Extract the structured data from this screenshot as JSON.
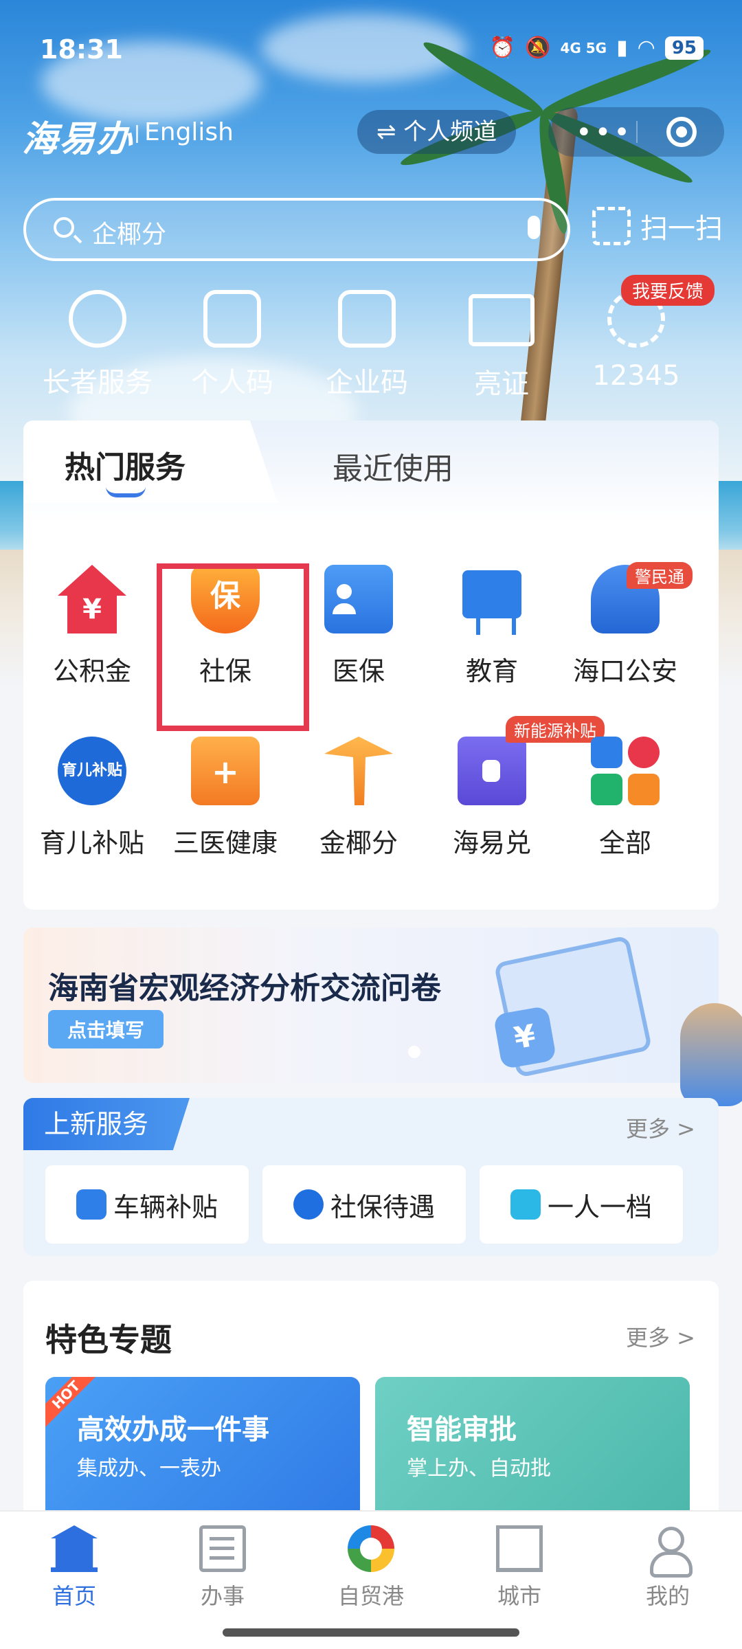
{
  "status_bar": {
    "time": "18:31",
    "network": "4G 5G",
    "battery": "95"
  },
  "header": {
    "logo": "海易办",
    "language": "English",
    "channel": "⇌ 个人频道"
  },
  "search": {
    "placeholder": "企椰分",
    "scan_label": "扫一扫"
  },
  "quick_entries": [
    {
      "label": "长者服务",
      "icon": "heart-plus-icon"
    },
    {
      "label": "个人码",
      "icon": "qr-code-icon"
    },
    {
      "label": "企业码",
      "icon": "grid-code-icon"
    },
    {
      "label": "亮证",
      "icon": "id-card-icon"
    },
    {
      "label": "12345",
      "icon": "hotline-icon",
      "badge": "我要反馈"
    }
  ],
  "services": {
    "tabs": [
      {
        "label": "热门服务",
        "active": true
      },
      {
        "label": "最近使用",
        "active": false
      }
    ],
    "items": [
      {
        "label": "公积金",
        "icon": "house-fund-icon",
        "glyph": "¥"
      },
      {
        "label": "社保",
        "icon": "shield-insurance-icon",
        "glyph": "保",
        "highlighted": true
      },
      {
        "label": "医保",
        "icon": "medical-card-icon"
      },
      {
        "label": "教育",
        "icon": "education-board-icon"
      },
      {
        "label": "海口公安",
        "icon": "police-cap-icon",
        "badge": "警民通"
      },
      {
        "label": "育儿补贴",
        "icon": "childcare-bag-icon",
        "glyph": "育儿补贴"
      },
      {
        "label": "三医健康",
        "icon": "medkit-icon",
        "glyph": "+"
      },
      {
        "label": "金椰分",
        "icon": "palm-tree-icon"
      },
      {
        "label": "海易兑",
        "icon": "exchange-phone-icon",
        "badge": "新能源补贴"
      },
      {
        "label": "全部",
        "icon": "all-apps-icon"
      }
    ]
  },
  "banner": {
    "title": "海南省宏观经济分析交流问卷",
    "button": "点击填写",
    "glyph": "¥"
  },
  "new_services": {
    "title": "上新服务",
    "more": "更多 >",
    "items": [
      {
        "label": "车辆补贴",
        "icon": "vehicle-subsidy-icon"
      },
      {
        "label": "社保待遇",
        "icon": "social-security-icon"
      },
      {
        "label": "一人一档",
        "icon": "personal-file-icon"
      }
    ]
  },
  "featured": {
    "title": "特色专题",
    "more": "更多 >",
    "cards": [
      {
        "title": "高效办成一件事",
        "subtitle": "集成办、一表办",
        "tag": "HOT",
        "color": "#3d8ff0"
      },
      {
        "title": "智能审批",
        "subtitle": "掌上办、自动批",
        "color": "#59c1b6"
      }
    ]
  },
  "tab_bar": [
    {
      "label": "首页",
      "icon": "home-icon",
      "active": true
    },
    {
      "label": "办事",
      "icon": "checklist-icon",
      "active": false
    },
    {
      "label": "自贸港",
      "icon": "free-trade-port-icon",
      "active": false
    },
    {
      "label": "城市",
      "icon": "city-building-icon",
      "active": false
    },
    {
      "label": "我的",
      "icon": "profile-icon",
      "active": false
    }
  ],
  "colors": {
    "accent": "#2e6fe0",
    "highlight_box": "#e53950",
    "badge": "#e53935"
  }
}
